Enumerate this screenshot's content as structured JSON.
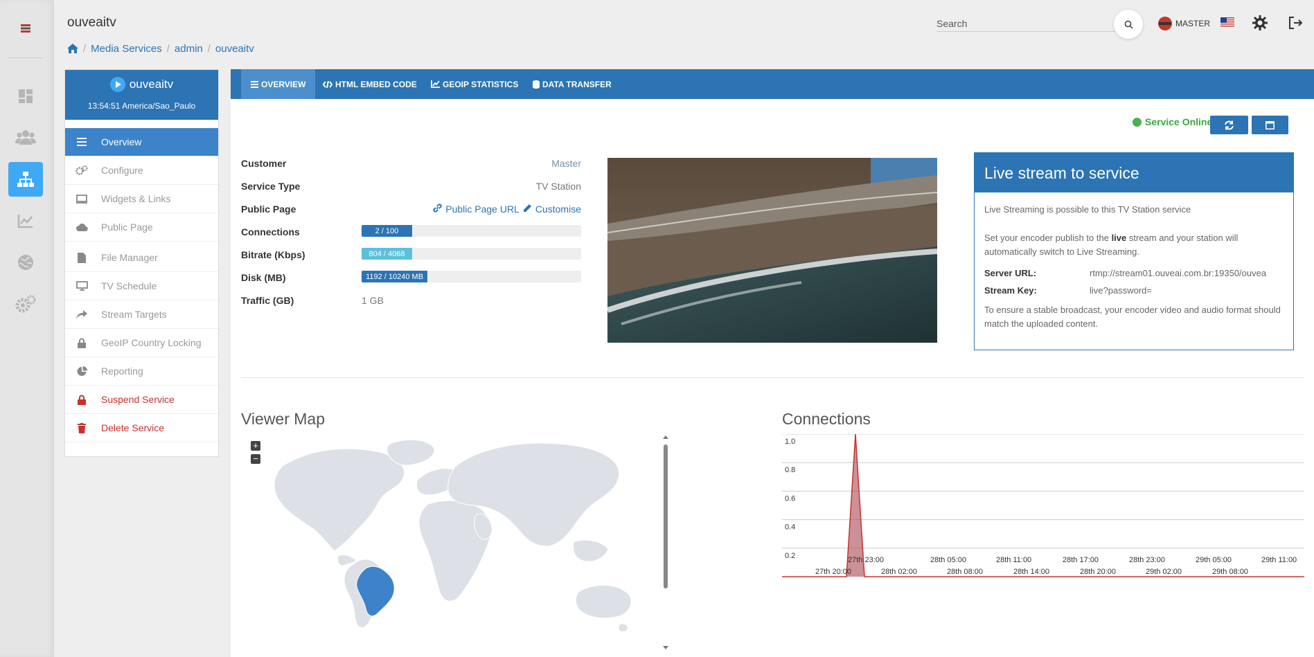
{
  "app": {
    "title": "ouveaitv"
  },
  "breadcrumb": {
    "items": [
      "Media Services",
      "admin",
      "ouveaitv"
    ]
  },
  "header": {
    "search_placeholder": "Search",
    "user_label": "MASTER"
  },
  "sidebar": {
    "station_name": "ouveaitv",
    "time": "13:54:51 America/Sao_Paulo",
    "items": [
      {
        "label": "Overview",
        "icon": "list-icon"
      },
      {
        "label": "Configure",
        "icon": "gears-icon"
      },
      {
        "label": "Widgets & Links",
        "icon": "widget-icon"
      },
      {
        "label": "Public Page",
        "icon": "cloud-icon"
      },
      {
        "label": "File Manager",
        "icon": "file-icon"
      },
      {
        "label": "TV Schedule",
        "icon": "monitor-icon"
      },
      {
        "label": "Stream Targets",
        "icon": "share-icon"
      },
      {
        "label": "GeoIP Country Locking",
        "icon": "lock-icon"
      },
      {
        "label": "Reporting",
        "icon": "pie-chart-icon"
      },
      {
        "label": "Suspend Service",
        "icon": "lock-icon"
      },
      {
        "label": "Delete Service",
        "icon": "trash-icon"
      }
    ]
  },
  "tabs": [
    {
      "label": "OVERVIEW",
      "icon": "list-icon"
    },
    {
      "label": "HTML EMBED CODE",
      "icon": "code-icon"
    },
    {
      "label": "GEOIP STATISTICS",
      "icon": "area-chart-icon"
    },
    {
      "label": "DATA TRANSFER",
      "icon": "database-icon"
    }
  ],
  "status": {
    "text": "Service Online",
    "color": "#4bb04e"
  },
  "info": {
    "customer_label": "Customer",
    "customer_value": "Master",
    "service_type_label": "Service Type",
    "service_type_value": "TV Station",
    "public_page_label": "Public Page",
    "public_page_url": "Public Page URL",
    "customise": "Customise",
    "connections_label": "Connections",
    "connections_text": "2 / 100",
    "connections_fraction": 0.23,
    "bitrate_label": "Bitrate (Kbps)",
    "bitrate_text": "804 / 4068",
    "bitrate_fraction": 0.23,
    "disk_label": "Disk (MB)",
    "disk_text": "1192 / 10240 MB",
    "disk_fraction": 0.3,
    "traffic_label": "Traffic (GB)",
    "traffic_value": "1 GB"
  },
  "live": {
    "title": "Live stream to service",
    "intro": "Live Streaming is possible to this TV Station service",
    "instr_pre": "Set your encoder publish to the ",
    "instr_bold": "live",
    "instr_post": " stream and your station will automatically switch to Live Streaming.",
    "server_label": "Server URL:",
    "server_value": "rtmp://stream01.ouveai.com.br:19350/ouvea",
    "key_label": "Stream Key:",
    "key_value": "live?password=",
    "note": "To ensure a stable broadcast, your encoder video and audio format should match the uploaded content."
  },
  "viewer_map": {
    "title": "Viewer Map",
    "highlighted": "Brazil",
    "highlight_color": "#3c83c9"
  },
  "chart_data": {
    "type": "area",
    "title": "Connections",
    "x": [
      "27th 19:00",
      "27th 20:00",
      "27th 21:00",
      "27th 22:00"
    ],
    "values": [
      0,
      0,
      1,
      0
    ],
    "ylim": [
      0,
      1.0
    ],
    "y_ticks": [
      "1.0",
      "0.8",
      "0.6",
      "0.4",
      "0.2"
    ],
    "x_ticks_upper": [
      "27th 23:00",
      "28th 05:00",
      "28th 11:00",
      "28th 17:00",
      "28th 23:00",
      "29th 05:00",
      "29th 11:00"
    ],
    "x_ticks_lower": [
      "27th 20:00",
      "28th 02:00",
      "28th 08:00",
      "28th 14:00",
      "28th 20:00",
      "29th 02:00",
      "29th 08:00"
    ],
    "series_color": "#c9302c",
    "fill_color": "#b05560"
  }
}
